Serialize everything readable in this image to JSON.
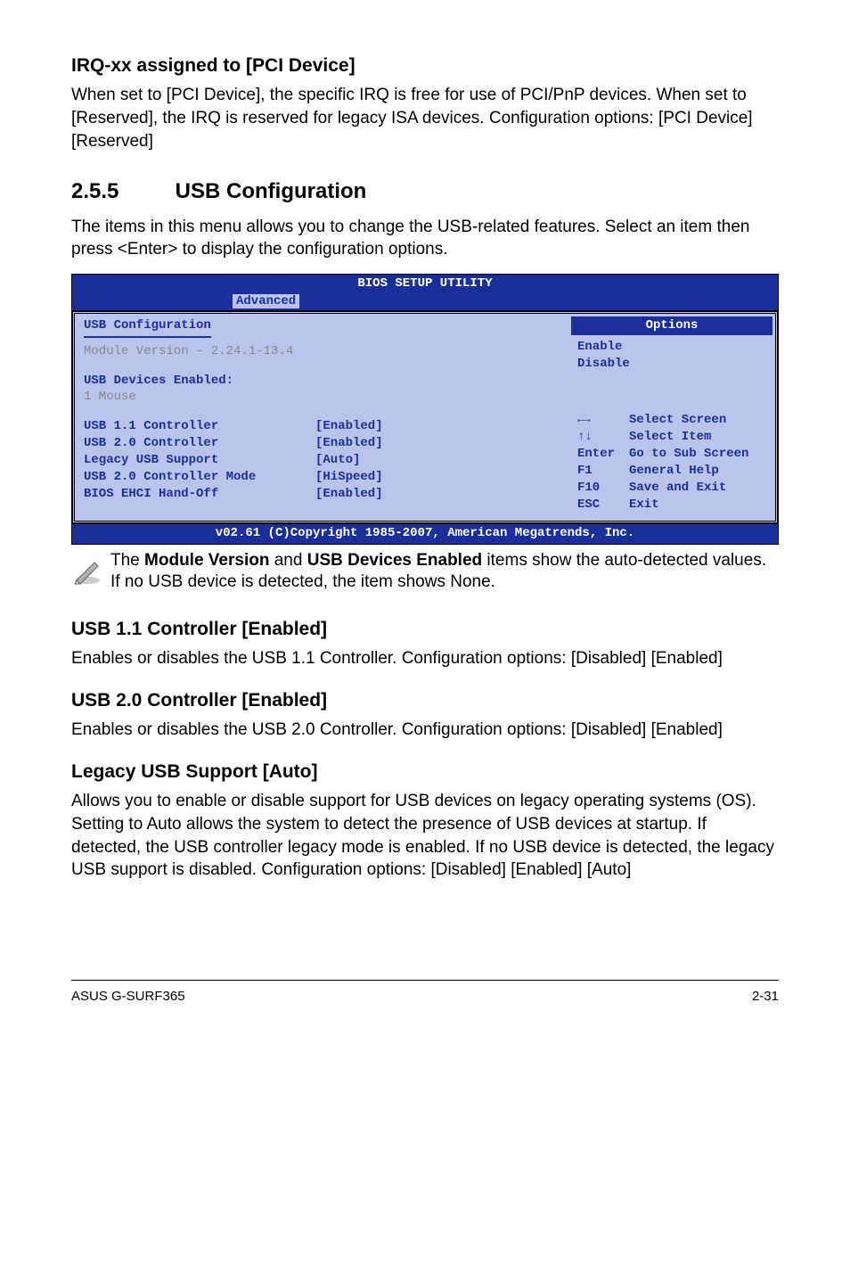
{
  "h_irq": "IRQ-xx assigned to [PCI Device]",
  "p_irq": "When set to [PCI Device], the specific IRQ is free for use of PCI/PnP devices. When set to [Reserved], the IRQ is reserved for legacy ISA devices. Configuration options: [PCI Device] [Reserved]",
  "sec_no": "2.5.5",
  "sec_title": "USB Configuration",
  "sec_intro": "The items in this menu allows you to change the USB-related features. Select an item then press <Enter> to display the configuration options.",
  "bios": {
    "title": "BIOS SETUP UTILITY",
    "tab": "Advanced",
    "left_hdr": "USB Configuration",
    "mod_ver": "Module Version - 2.24.1-13.4",
    "dev_hdr": "USB Devices Enabled:",
    "dev_line": " 1 Mouse",
    "rows": [
      {
        "k": "USB 1.1 Controller",
        "v": "[Enabled]"
      },
      {
        "k": "USB 2.0 Controller",
        "v": "[Enabled]"
      },
      {
        "k": "Legacy USB Support",
        "v": "[Auto]"
      },
      {
        "k": "USB 2.0 Controller Mode",
        "v": "[HiSpeed]"
      },
      {
        "k": "BIOS EHCI Hand-Off",
        "v": "[Enabled]"
      }
    ],
    "opt_title": "Options",
    "opt1": "Enable",
    "opt2": "Disable",
    "help": [
      {
        "k": "←→",
        "t": "Select Screen"
      },
      {
        "k": "↑↓",
        "t": "Select Item"
      },
      {
        "k": "Enter",
        "t": "Go to Sub Screen"
      },
      {
        "k": "F1",
        "t": "General Help"
      },
      {
        "k": "F10",
        "t": "Save and Exit"
      },
      {
        "k": "ESC",
        "t": "Exit"
      }
    ],
    "footer": "v02.61 (C)Copyright 1985-2007, American Megatrends, Inc."
  },
  "note_pre": "The ",
  "note_b1": "Module Version",
  "note_mid": " and ",
  "note_b2": "USB Devices Enabled",
  "note_post": " items show the auto-detected values. If no USB device is detected, the item shows None.",
  "h_11": "USB 1.1 Controller [Enabled]",
  "p_11": "Enables or disables the USB 1.1 Controller. Configuration options: [Disabled] [Enabled]",
  "h_20": "USB 2.0 Controller [Enabled]",
  "p_20": "Enables or disables the USB 2.0 Controller. Configuration options: [Disabled] [Enabled]",
  "h_legacy": "Legacy USB Support [Auto]",
  "p_legacy": "Allows you to enable or disable support for USB devices on legacy operating systems (OS). Setting to Auto allows the system to detect the presence of USB devices at startup. If detected, the USB controller legacy mode is enabled. If no USB device is detected, the legacy USB support is disabled. Configuration options: [Disabled] [Enabled] [Auto]",
  "footer_left": "ASUS G-SURF365",
  "footer_right": "2-31"
}
